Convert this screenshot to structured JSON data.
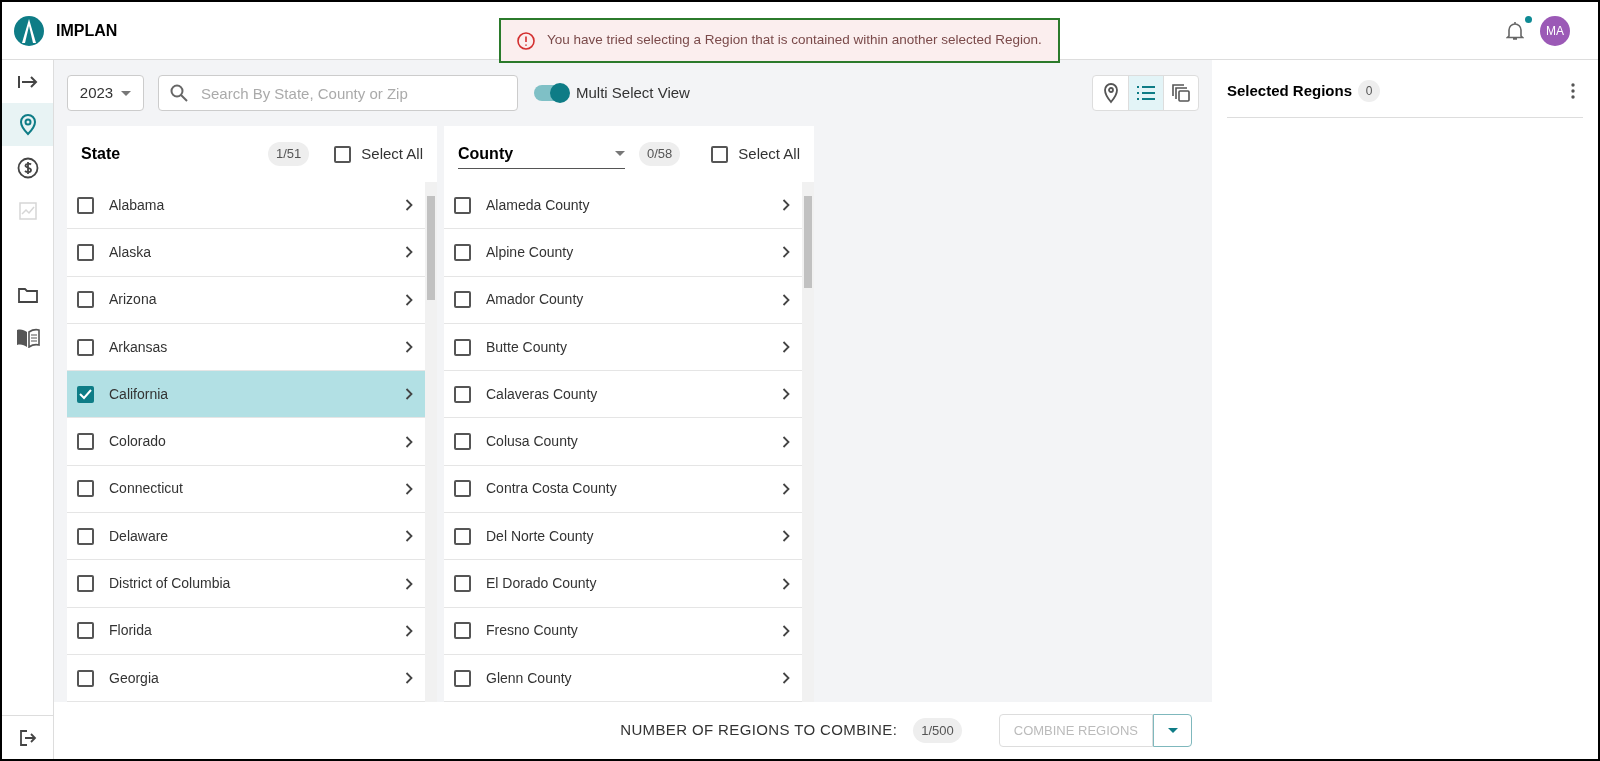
{
  "app": {
    "name": "IMPLAN",
    "avatar": "MA",
    "notification_unread": true
  },
  "alert": {
    "message": "You have tried selecting a Region that is contained within another selected Region."
  },
  "sidebar": {
    "items": [
      {
        "kind": "expand",
        "selected": false,
        "disabled": false
      },
      {
        "kind": "pin",
        "selected": true,
        "disabled": false
      },
      {
        "kind": "dollar",
        "selected": false,
        "disabled": false
      },
      {
        "kind": "chart",
        "selected": false,
        "disabled": true
      },
      {
        "kind": "folder",
        "selected": false,
        "disabled": false
      },
      {
        "kind": "book",
        "selected": false,
        "disabled": false
      }
    ]
  },
  "toolbar": {
    "year": "2023",
    "search": {
      "placeholder": "Search By State, County or Zip"
    },
    "multi_select": {
      "label": "Multi Select View",
      "on": true
    },
    "views": [
      {
        "kind": "map",
        "selected": false
      },
      {
        "kind": "list",
        "selected": true
      },
      {
        "kind": "copy",
        "selected": false
      }
    ]
  },
  "state_list": {
    "title": "State",
    "count": "1/51",
    "select_all": {
      "label": "Select All",
      "checked": false
    },
    "items": [
      {
        "name": "Alabama",
        "checked": false
      },
      {
        "name": "Alaska",
        "checked": false
      },
      {
        "name": "Arizona",
        "checked": false
      },
      {
        "name": "Arkansas",
        "checked": false
      },
      {
        "name": "California",
        "checked": true
      },
      {
        "name": "Colorado",
        "checked": false
      },
      {
        "name": "Connecticut",
        "checked": false
      },
      {
        "name": "Delaware",
        "checked": false
      },
      {
        "name": "District of Columbia",
        "checked": false
      },
      {
        "name": "Florida",
        "checked": false
      },
      {
        "name": "Georgia",
        "checked": false
      }
    ]
  },
  "county_list": {
    "title": "County",
    "count": "0/58",
    "select_all": {
      "label": "Select All",
      "checked": false
    },
    "items": [
      {
        "name": "Alameda County",
        "checked": false
      },
      {
        "name": "Alpine County",
        "checked": false
      },
      {
        "name": "Amador County",
        "checked": false
      },
      {
        "name": "Butte County",
        "checked": false
      },
      {
        "name": "Calaveras County",
        "checked": false
      },
      {
        "name": "Colusa County",
        "checked": false
      },
      {
        "name": "Contra Costa County",
        "checked": false
      },
      {
        "name": "Del Norte County",
        "checked": false
      },
      {
        "name": "El Dorado County",
        "checked": false
      },
      {
        "name": "Fresno County",
        "checked": false
      },
      {
        "name": "Glenn County",
        "checked": false
      }
    ]
  },
  "selected_regions": {
    "title": "Selected Regions",
    "count": "0"
  },
  "footer": {
    "label": "NUMBER OF REGIONS TO COMBINE:",
    "count": "1/500",
    "combine_button": {
      "label": "COMBINE REGIONS",
      "disabled": true
    }
  }
}
